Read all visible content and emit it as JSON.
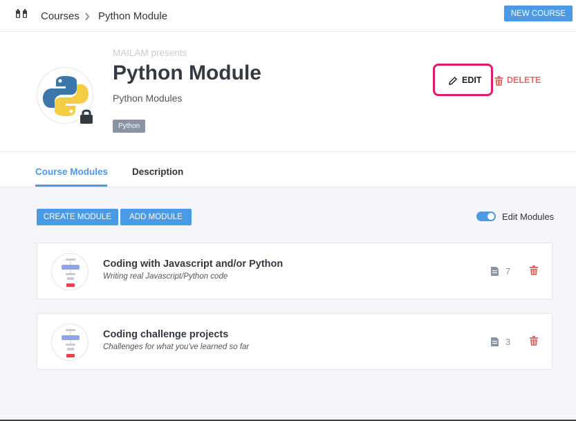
{
  "topbar": {
    "logo_icon": "app-logo-icon",
    "breadcrumb": [
      "Courses",
      "Python Module"
    ],
    "separator_icon": "chevron-right-icon",
    "new_course_label": "NEW COURSE"
  },
  "header": {
    "presents": "MAILAM presents",
    "title": "Python Module",
    "subtitle": "Python Modules",
    "tag": "Python",
    "avatar_icon": "python-logo-icon",
    "lock_icon": "lock-icon",
    "edit_label": "EDIT",
    "delete_label": "DELETE",
    "accent_color": "#4a9ae6",
    "delete_color": "#e36a63",
    "highlight_color": "#e0196d"
  },
  "tabs": [
    {
      "label": "Course Modules",
      "active": true
    },
    {
      "label": "Description",
      "active": false
    }
  ],
  "toolbar": {
    "create_module_label": "CREATE MODULE",
    "add_module_label": "ADD MODULE",
    "edit_modules_label": "Edit Modules",
    "edit_modules_on": true
  },
  "modules": [
    {
      "title": "Coding with Javascript and/or Python",
      "subtitle": "Writing real Javascript/Python code",
      "count": "7"
    },
    {
      "title": "Coding challenge projects",
      "subtitle": "Challenges for what you've learned so far",
      "count": "3"
    }
  ]
}
